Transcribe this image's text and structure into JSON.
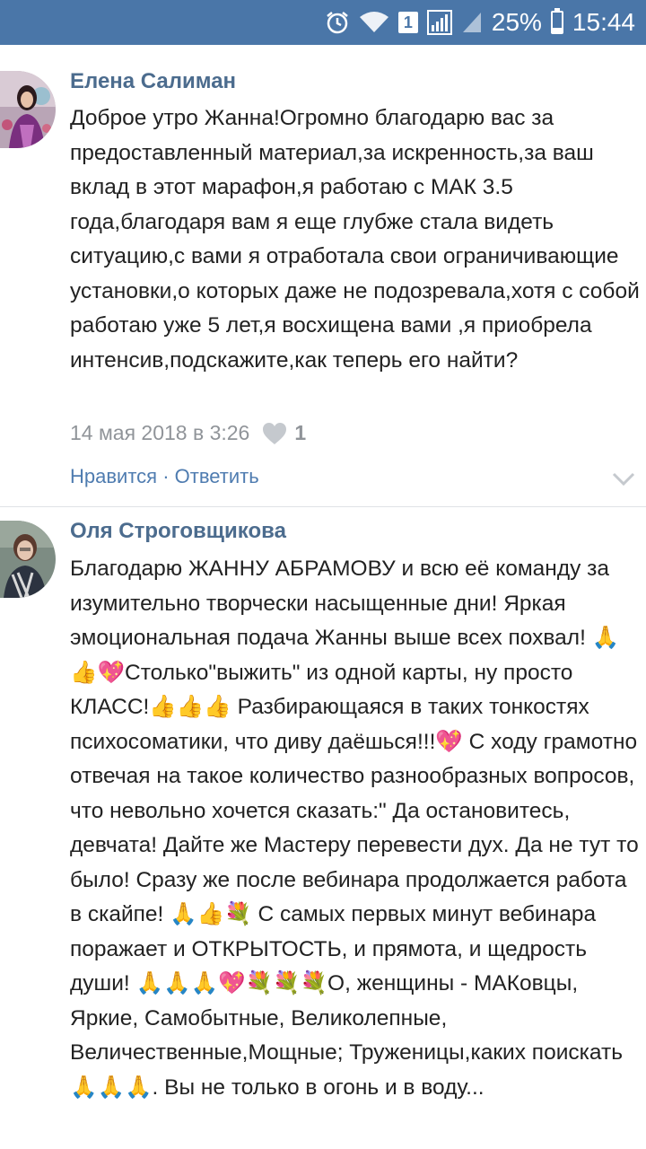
{
  "status_bar": {
    "sim_slot": "1",
    "battery_level_percent": 25,
    "battery_text": "25%",
    "time": "15:44",
    "icons": [
      "alarm-icon",
      "wifi-icon",
      "sim-1-icon",
      "signal-icon",
      "signal-no-data-icon",
      "battery-icon"
    ]
  },
  "comments": [
    {
      "author": "Елена Салиман",
      "text": "Доброе утро Жанна!Огромно благодарю вас за предоставленный материал,за искренность,за ваш вклад в этот марафон,я работаю с МАК 3.5 года,благодаря вам я еще глубже стала видеть ситуацию,с вами я отработала свои ограничивающие установки,о которых даже не подозревала,хотя с собой работаю уже 5 лет,я восхищена вами ,я приобрела интенсив,подскажите,как теперь его найти?",
      "timestamp": "14 мая 2018 в 3:26",
      "likes": "1",
      "like_label": "Нравится",
      "separator": " · ",
      "reply_label": "Ответить"
    },
    {
      "author": "Оля Строговщикова",
      "text": "Благодарю ЖАННУ АБРАМОВУ и всю её команду за изумительно творчески насыщенные дни! Яркая эмоциональная подача Жанны выше всех похвал! 🙏👍💖Столько\"выжить\" из одной карты, ну просто КЛАСС!👍👍👍 Разбирающаяся в таких тонкостях психосоматики, что диву даёшься!!!💖 С ходу грамотно отвечая на такое количество разнообразных вопросов, что невольно хочется сказать:\" Да остановитесь, девчата! Дайте же Мастеру перевести дух. Да не тут то было! Сразу же после вебинара продолжается работа в скайпе! 🙏👍💐 С самых первых минут вебинара поражает и ОТКРЫТОСТЬ, и прямота, и щедрость души! 🙏🙏🙏💖💐💐💐О, женщины - МАКовцы, Яркие, Самобытные, Великолепные, Величественные,Мощные; Труженицы,каких поискать🙏🙏🙏. Вы не только в огонь и в воду..."
    }
  ]
}
